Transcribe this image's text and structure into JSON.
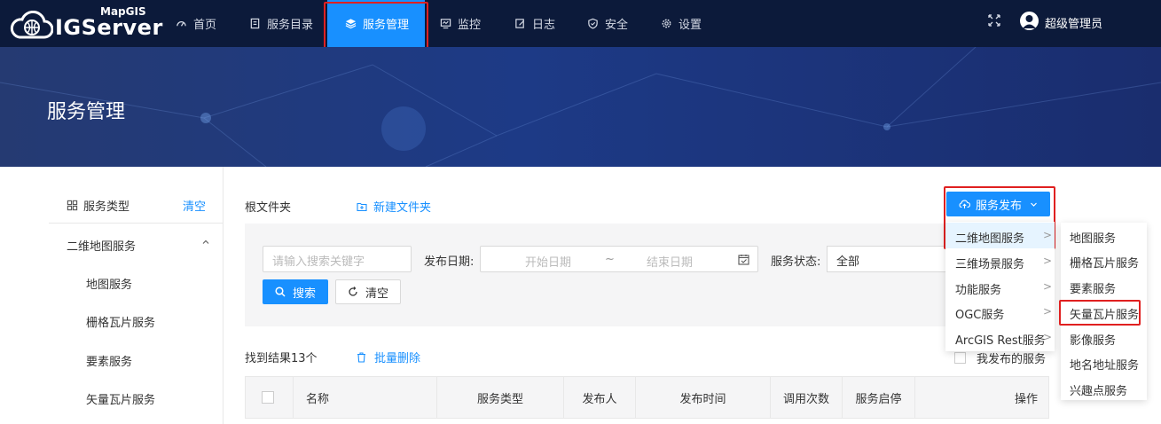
{
  "brand": {
    "small": "MapGIS",
    "name": "IGServer"
  },
  "nav": {
    "items": [
      {
        "label": "首页",
        "icon": "dashboard-icon"
      },
      {
        "label": "服务目录",
        "icon": "catalog-icon"
      },
      {
        "label": "服务管理",
        "icon": "layers-icon",
        "active": true
      },
      {
        "label": "监控",
        "icon": "monitor-icon"
      },
      {
        "label": "日志",
        "icon": "log-icon"
      },
      {
        "label": "安全",
        "icon": "shield-icon"
      },
      {
        "label": "设置",
        "icon": "gear-icon"
      }
    ],
    "user": "超级管理员"
  },
  "banner": {
    "title": "服务管理"
  },
  "sidebar": {
    "header": "服务类型",
    "clear": "清空",
    "group": "二维地图服务",
    "items": [
      "地图服务",
      "栅格瓦片服务",
      "要素服务",
      "矢量瓦片服务"
    ]
  },
  "main": {
    "breadcrumb": "根文件夹",
    "new_folder": "新建文件夹",
    "search_placeholder": "请输入搜索关键字",
    "date_label": "发布日期:",
    "start_date": "开始日期",
    "date_sep": "~",
    "end_date": "结束日期",
    "status_label": "服务状态:",
    "status_value": "全部",
    "search_btn": "搜索",
    "clear_btn": "清空",
    "results": "找到结果13个",
    "batch_delete": "批量删除",
    "my_published": "我发布的服务",
    "columns": [
      "名称",
      "服务类型",
      "发布人",
      "发布时间",
      "调用次数",
      "服务启停",
      "操作"
    ]
  },
  "publish": {
    "button": "服务发布",
    "menu": [
      "二维地图服务",
      "三维场景服务",
      "功能服务",
      "OGC服务",
      "ArcGIS Rest服务"
    ],
    "arrow": ">",
    "submenu": [
      "地图服务",
      "栅格瓦片服务",
      "要素服务",
      "矢量瓦片服务",
      "影像服务",
      "地名地址服务",
      "兴趣点服务"
    ]
  },
  "colors": {
    "nav_bg": "#0c1a3a",
    "accent": "#1890ff",
    "highlight_box": "#e02020"
  }
}
